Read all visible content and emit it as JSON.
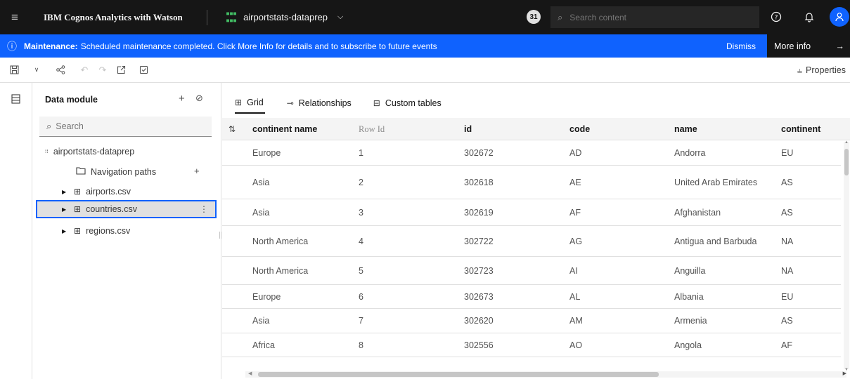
{
  "topbar": {
    "app_title": "IBM Cognos Analytics with Watson",
    "module_name": "airportstats-dataprep",
    "notification_count": "31",
    "search_placeholder": "Search content"
  },
  "banner": {
    "label": "Maintenance:",
    "message": "Scheduled maintenance completed. Click More Info for details and to subscribe to future events",
    "dismiss_label": "Dismiss",
    "more_info_label": "More info"
  },
  "toolbar": {
    "properties_label": "Properties"
  },
  "panel": {
    "title": "Data module",
    "search_placeholder": "Search",
    "root": "airportstats-dataprep",
    "navigation_paths": "Navigation paths",
    "tables": [
      "airports.csv",
      "countries.csv",
      "regions.csv"
    ]
  },
  "tabs": [
    "Grid",
    "Relationships",
    "Custom tables"
  ],
  "grid": {
    "columns": [
      "continent name",
      "Row Id",
      "id",
      "code",
      "name",
      "continent"
    ],
    "rows": [
      [
        "Europe",
        "1",
        "302672",
        "AD",
        "Andorra",
        "EU"
      ],
      [
        "Asia",
        "2",
        "302618",
        "AE",
        "United Arab Emirates",
        "AS"
      ],
      [
        "Asia",
        "3",
        "302619",
        "AF",
        "Afghanistan",
        "AS"
      ],
      [
        "North America",
        "4",
        "302722",
        "AG",
        "Antigua and Barbuda",
        "NA"
      ],
      [
        "North America",
        "5",
        "302723",
        "AI",
        "Anguilla",
        "NA"
      ],
      [
        "Europe",
        "6",
        "302673",
        "AL",
        "Albania",
        "EU"
      ],
      [
        "Asia",
        "7",
        "302620",
        "AM",
        "Armenia",
        "AS"
      ],
      [
        "Africa",
        "8",
        "302556",
        "AO",
        "Angola",
        "AF"
      ]
    ]
  },
  "colors": {
    "topbar_bg": "#161616",
    "banner_bg": "#0f62fe",
    "selection_border": "#0f62fe",
    "module_icon": "#42be65"
  },
  "icons": {
    "menu": "hamburger-icon",
    "module": "data-module-icon",
    "search": "search-icon",
    "help": "help-icon",
    "notifications": "bell-icon",
    "user": "user-icon",
    "info": "info-icon",
    "arrow": "arrow-right-icon"
  }
}
